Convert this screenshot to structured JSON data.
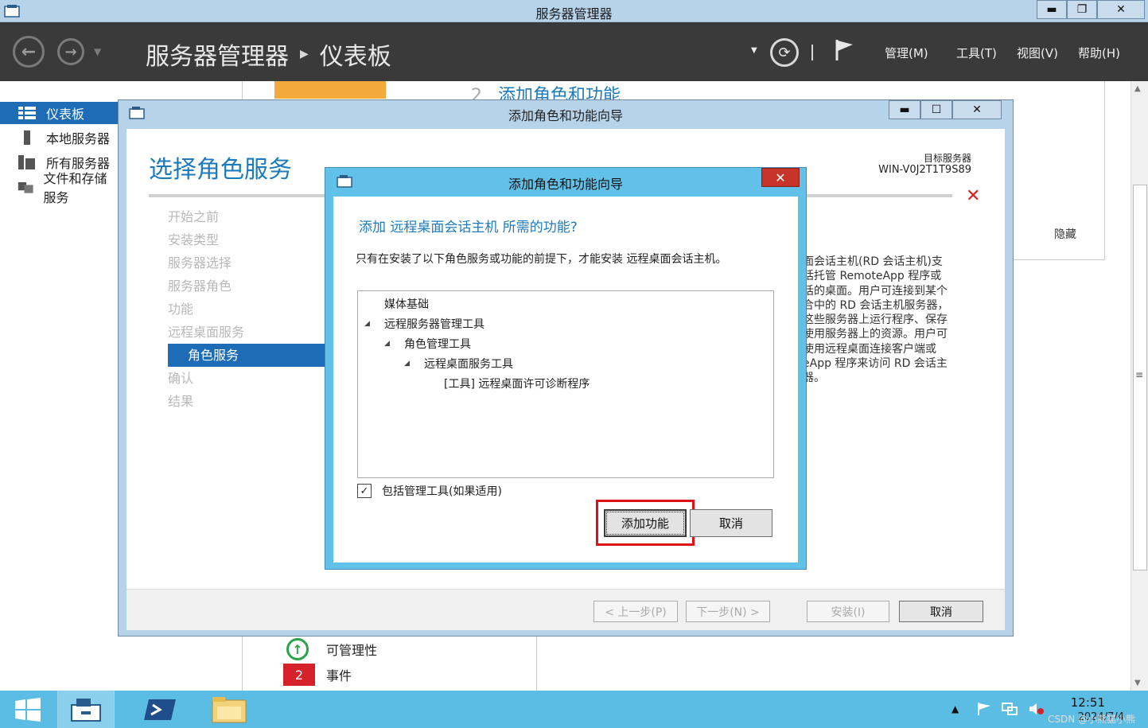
{
  "app": {
    "title": "服务器管理器",
    "breadcrumb": [
      "服务器管理器",
      "仪表板"
    ],
    "menus": [
      "管理(M)",
      "工具(T)",
      "视图(V)",
      "帮助(H)"
    ]
  },
  "sidebar": {
    "items": [
      {
        "label": "仪表板",
        "icon": "dashboard-icon",
        "active": true
      },
      {
        "label": "本地服务器",
        "icon": "server-icon"
      },
      {
        "label": "所有服务器",
        "icon": "servers-icon"
      },
      {
        "label": "文件和存储服务",
        "icon": "storage-icon"
      }
    ]
  },
  "dashboard": {
    "step_number": "2",
    "step_label": "添加角色和功能",
    "hide_label": "隐藏",
    "manageability_label": "可管理性",
    "events_count": "2",
    "events_label": "事件"
  },
  "wizard": {
    "title": "添加角色和功能向导",
    "heading": "选择角色服务",
    "target_label": "目标服务器",
    "target_name": "WIN-V0J2T1T9S89",
    "steps": [
      {
        "label": "开始之前"
      },
      {
        "label": "安装类型"
      },
      {
        "label": "服务器选择"
      },
      {
        "label": "服务器角色"
      },
      {
        "label": "功能"
      },
      {
        "label": "远程桌面服务"
      },
      {
        "label": "角色服务",
        "active": true
      },
      {
        "label": "确认"
      },
      {
        "label": "结果"
      }
    ],
    "description_lines": [
      "面会话主机(RD 会话主机)支",
      "括托管 RemoteApp 程序或",
      "话的桌面。用户可连接到某个",
      "合中的 RD 会话主机服务器，",
      "这些服务器上运行程序、保存",
      "使用服务器上的资源。用户可",
      "使用远程桌面连接客户端或",
      "eApp 程序来访问 RD 会话主",
      "器。"
    ],
    "buttons": {
      "prev": "< 上一步(P)",
      "next": "下一步(N) >",
      "install": "安装(I)",
      "cancel": "取消"
    }
  },
  "dialog": {
    "title": "添加角色和功能向导",
    "question": "添加 远程桌面会话主机 所需的功能?",
    "description": "只有在安装了以下角色服务或功能的前提下，才能安装 远程桌面会话主机。",
    "tree": [
      {
        "label": "媒体基础",
        "level": 0,
        "expander": false
      },
      {
        "label": "远程服务器管理工具",
        "level": 0,
        "expander": true
      },
      {
        "label": "角色管理工具",
        "level": 1,
        "expander": true
      },
      {
        "label": "远程桌面服务工具",
        "level": 2,
        "expander": true
      },
      {
        "label": "[工具] 远程桌面许可诊断程序",
        "level": 3,
        "expander": false
      }
    ],
    "include_tools_label": "包括管理工具(如果适用)",
    "include_tools_checked": true,
    "add_features_button": "添加功能",
    "cancel_button": "取消"
  },
  "taskbar": {
    "time": "12:51",
    "date": "2024/7/4",
    "watermark": "CSDN @小熊猫小熊"
  }
}
